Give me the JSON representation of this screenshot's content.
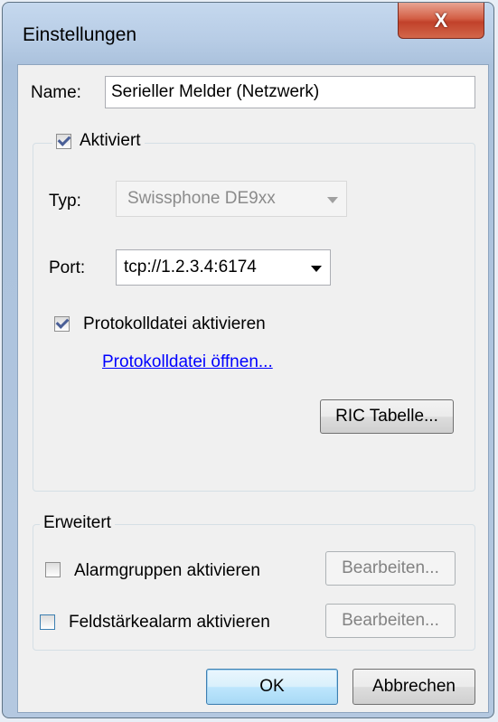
{
  "window": {
    "title": "Einstellungen",
    "close_label": "X"
  },
  "name_field": {
    "label": "Name:",
    "value": "Serieller Melder (Netzwerk)"
  },
  "enabled_group": {
    "checkbox_label": "Aktiviert",
    "type_label": "Typ:",
    "type_value": "Swissphone DE9xx",
    "port_label": "Port:",
    "port_value": "tcp://1.2.3.4:6174",
    "logfile_label": "Protokolldatei aktivieren",
    "logfile_link": "Protokolldatei öffnen...",
    "ric_button": "RIC Tabelle..."
  },
  "advanced_group": {
    "title": "Erweitert",
    "alarmgroups_label": "Alarmgruppen aktivieren",
    "alarmgroups_edit": "Bearbeiten...",
    "fieldstrength_label": "Feldstärkealarm aktivieren",
    "fieldstrength_edit": "Bearbeiten..."
  },
  "footer": {
    "ok_label": "OK",
    "cancel_label": "Abbrechen"
  }
}
